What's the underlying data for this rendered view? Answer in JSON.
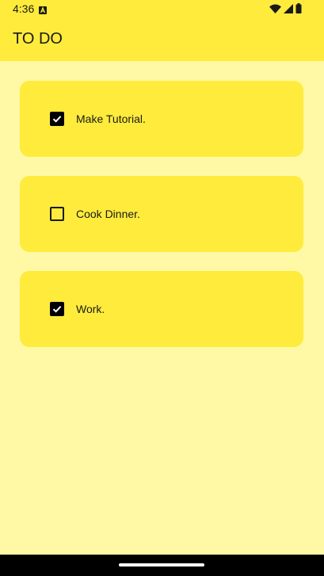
{
  "status_bar": {
    "time": "4:36",
    "icons": [
      "notification-a-icon",
      "wifi-icon",
      "signal-icon",
      "battery-icon"
    ]
  },
  "app_bar": {
    "title": "TO DO"
  },
  "colors": {
    "app_bar": "#ffeb3b",
    "background": "#fff9a6",
    "card": "#ffeb3b",
    "checkbox_checked": "#000000",
    "text": "#1a1a1a",
    "nav_bar": "#000000"
  },
  "todos": [
    {
      "label": "Make Tutorial.",
      "checked": true
    },
    {
      "label": "Cook Dinner.",
      "checked": false
    },
    {
      "label": "Work.",
      "checked": true
    }
  ]
}
